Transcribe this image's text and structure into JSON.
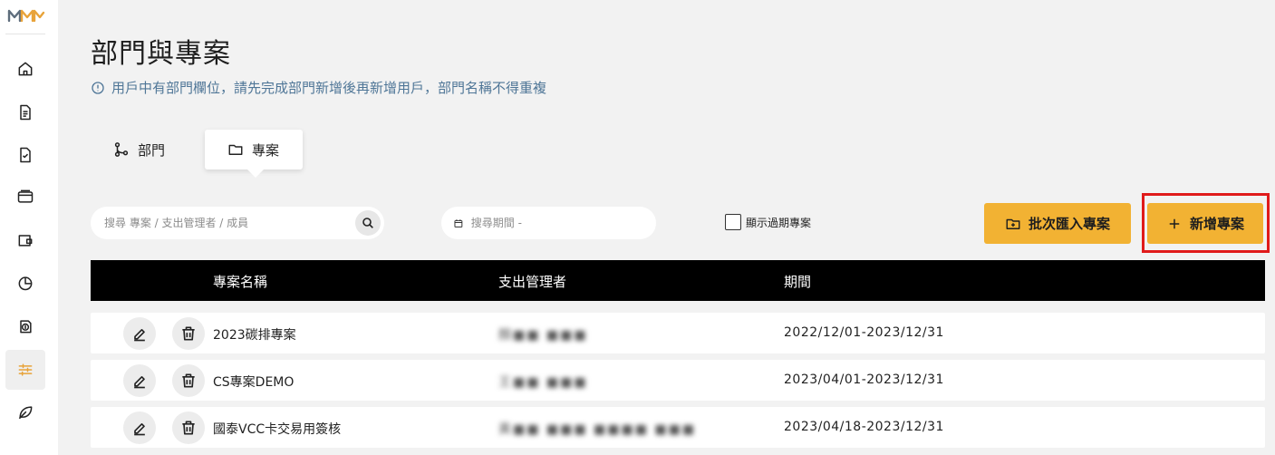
{
  "page": {
    "title": "部門與專案",
    "notice": "用戶中有部門欄位，請先完成部門新增後再新增用戶，部門名稱不得重複"
  },
  "tabs": [
    {
      "label": "部門",
      "icon": "branch-icon",
      "active": false
    },
    {
      "label": "專案",
      "icon": "folder-icon",
      "active": true
    }
  ],
  "filters": {
    "search_placeholder": "搜尋 專案 / 支出管理者 / 成員",
    "date_placeholder": "搜尋期間 -",
    "show_expired_label": "顯示過期專案",
    "show_expired_checked": false
  },
  "actions": {
    "import_label": "批次匯入專案",
    "add_label": "新增專案"
  },
  "table": {
    "columns": [
      "專案名稱",
      "支出管理者",
      "期間"
    ],
    "rows": [
      {
        "name": "2023碳排專案",
        "manager": "顏■■ ■■■",
        "period": "2022/12/01-2023/12/31"
      },
      {
        "name": "CS專案DEMO",
        "manager": "王■■ ■■■",
        "period": "2023/04/01-2023/12/31"
      },
      {
        "name": "國泰VCC卡交易用簽核",
        "manager": "黃■■ ■■■ ■■■■ ■■■",
        "period": "2023/04/18-2023/12/31"
      }
    ]
  },
  "sidebar": {
    "items": [
      "home-icon",
      "document-icon",
      "file-check-icon",
      "card-icon",
      "wallet-icon",
      "pie-chart-icon",
      "money-doc-icon",
      "sliders-icon",
      "leaf-icon"
    ],
    "active": "sliders-icon"
  },
  "colors": {
    "accent": "#f2b233",
    "notice": "#4f7697",
    "highlight": "#e01b1b",
    "logo": "#e8a33a"
  }
}
